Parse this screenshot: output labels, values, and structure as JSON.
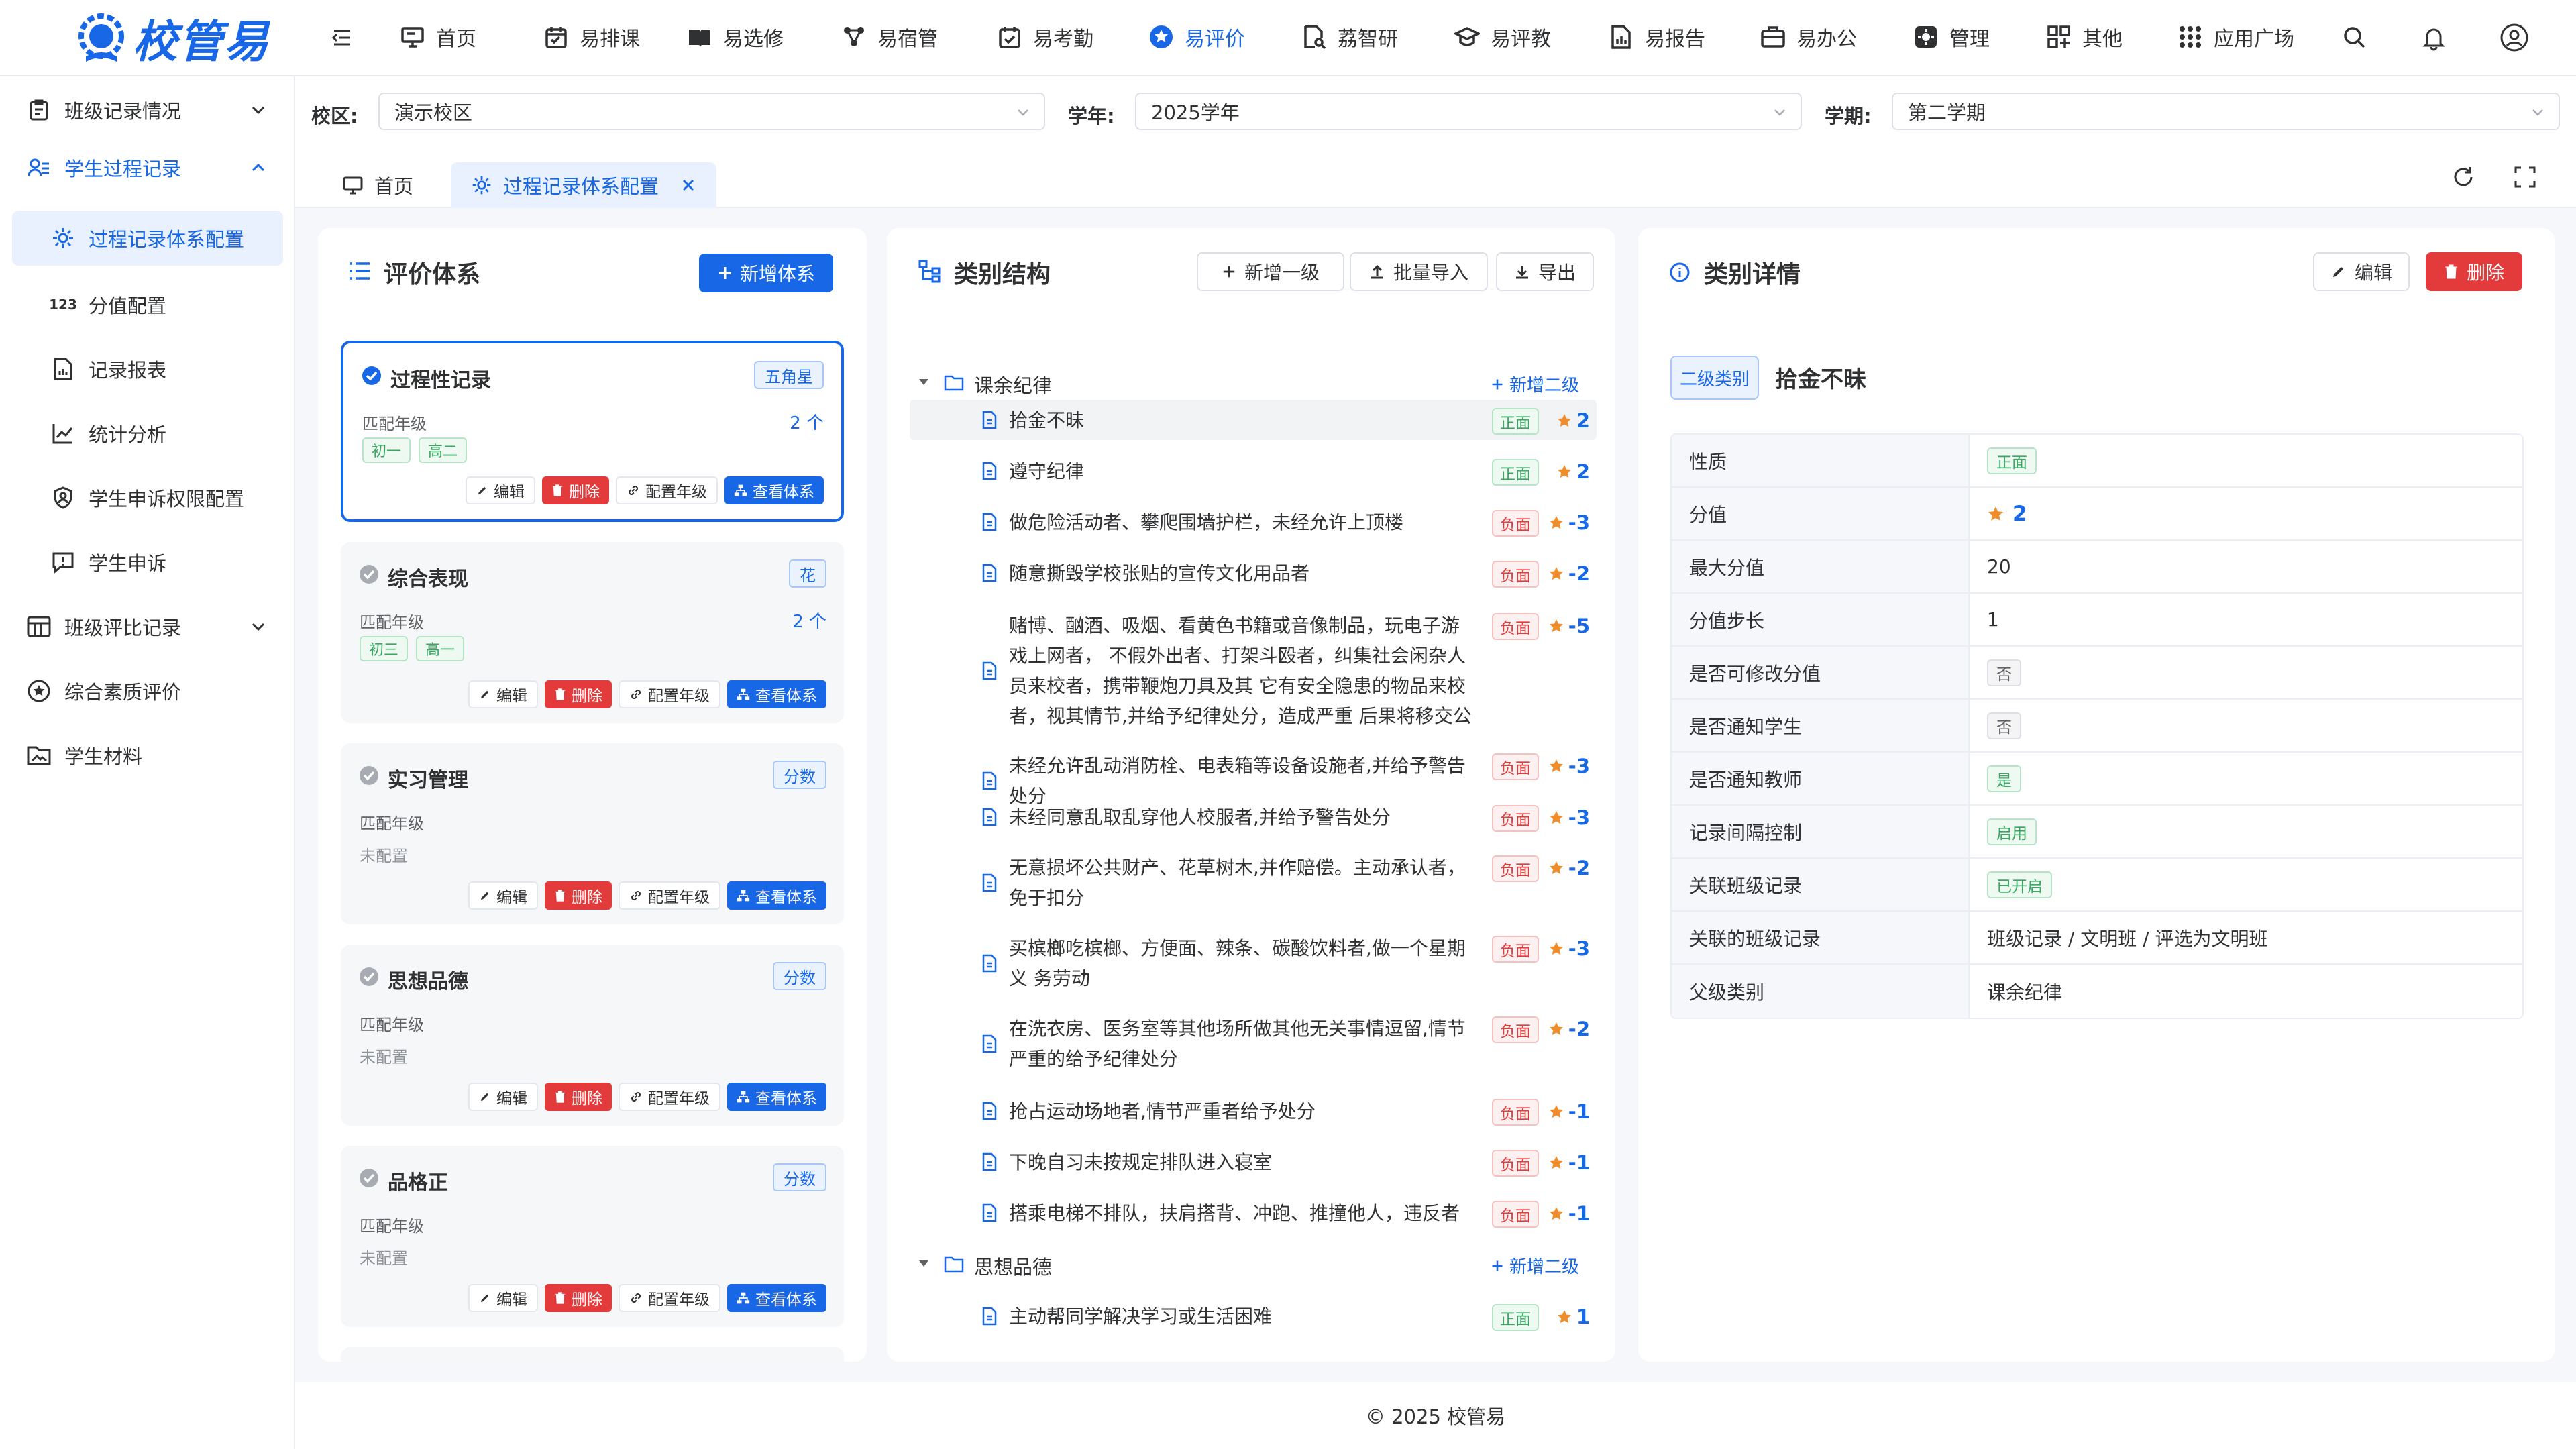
{
  "brand": {
    "name": "校管易"
  },
  "nav": {
    "items": [
      {
        "label": "首页",
        "icon": "monitor-icon"
      },
      {
        "label": "易排课",
        "icon": "calendar-icon"
      },
      {
        "label": "易选修",
        "icon": "book-icon"
      },
      {
        "label": "易宿管",
        "icon": "network-icon"
      },
      {
        "label": "易考勤",
        "icon": "checkbox-calendar-icon"
      },
      {
        "label": "易评价",
        "icon": "star-circle-icon"
      },
      {
        "label": "荔智研",
        "icon": "doc-search-icon"
      },
      {
        "label": "易评教",
        "icon": "graduation-cap-icon"
      },
      {
        "label": "易报告",
        "icon": "report-icon"
      },
      {
        "label": "易办公",
        "icon": "briefcase-icon"
      },
      {
        "label": "管理",
        "icon": "gear-box-icon"
      },
      {
        "label": "其他",
        "icon": "grid-plus-icon"
      },
      {
        "label": "应用广场",
        "icon": "apps-icon"
      }
    ],
    "active": "易评价"
  },
  "sidebar": {
    "items": [
      {
        "label": "班级记录情况",
        "icon": "clipboard-icon"
      },
      {
        "label": "学生过程记录",
        "icon": "user-list-icon"
      },
      {
        "label": "过程记录体系配置",
        "icon": "settings-icon"
      },
      {
        "label": "分值配置",
        "icon": "number-123-icon"
      },
      {
        "label": "记录报表",
        "icon": "report-file-icon"
      },
      {
        "label": "统计分析",
        "icon": "line-chart-icon"
      },
      {
        "label": "学生申诉权限配置",
        "icon": "shield-user-icon"
      },
      {
        "label": "学生申诉",
        "icon": "alert-message-icon"
      },
      {
        "label": "班级评比记录",
        "icon": "table-icon"
      },
      {
        "label": "综合素质评价",
        "icon": "star-circle-icon"
      },
      {
        "label": "学生材料",
        "icon": "folder-image-icon"
      }
    ]
  },
  "filters": {
    "campus_label": "校区:",
    "campus_value": "演示校区",
    "year_label": "学年:",
    "year_value": "2025学年",
    "term_label": "学期:",
    "term_value": "第二学期"
  },
  "tabs": {
    "home": "首页",
    "current": "过程记录体系配置"
  },
  "systems_panel": {
    "title": "评价体系",
    "add_button": "新增体系",
    "grade_label": "匹配年级",
    "none_label": "未配置",
    "actions": {
      "edit": "编辑",
      "delete": "删除",
      "config": "配置年级",
      "view": "查看体系"
    },
    "cards": [
      {
        "title": "过程性记录",
        "tag": "五角星",
        "count": "2 个",
        "grades": [
          "初一",
          "高二"
        ]
      },
      {
        "title": "综合表现",
        "tag": "花",
        "count": "2 个",
        "grades": [
          "初三",
          "高一"
        ]
      },
      {
        "title": "实习管理",
        "tag": "分数",
        "count": "",
        "grades": []
      },
      {
        "title": "思想品德",
        "tag": "分数",
        "count": "",
        "grades": []
      },
      {
        "title": "品格正",
        "tag": "分数",
        "count": "",
        "grades": []
      }
    ]
  },
  "structure_panel": {
    "title": "类别结构",
    "add_level1": "新增一级",
    "batch_import": "批量导入",
    "export": "导出",
    "add_level2": "新增二级",
    "groups": [
      {
        "label": "课余纪律",
        "items": [
          {
            "label": "拾金不昧",
            "type": "正面",
            "score": "2"
          },
          {
            "label": "遵守纪律",
            "type": "正面",
            "score": "2"
          },
          {
            "label": "做危险活动者、攀爬围墙护栏，未经允许上顶楼",
            "type": "负面",
            "score": "-3"
          },
          {
            "label": "随意撕毁学校张贴的宣传文化用品者",
            "type": "负面",
            "score": "-2"
          },
          {
            "label": "赌博、酗酒、吸烟、看黄色书籍或音像制品，玩电子游戏上网者， 不假外出者、打架斗殴者，纠集社会闲杂人员来校者，携带鞭炮刀具及其 它有安全隐患的物品来校者，视其情节,并给予纪律处分，造成严重 后果将移交公",
            "type": "负面",
            "score": "-5"
          },
          {
            "label": "未经允许乱动消防栓、电表箱等设备设施者,并给予警告处分",
            "type": "负面",
            "score": "-3"
          },
          {
            "label": "未经同意乱取乱穿他人校服者,并给予警告处分",
            "type": "负面",
            "score": "-3"
          },
          {
            "label": "无意损坏公共财产、花草树木,并作赔偿。主动承认者，免于扣分",
            "type": "负面",
            "score": "-2"
          },
          {
            "label": "买槟榔吃槟榔、方便面、辣条、碳酸饮料者,做一个星期义 务劳动",
            "type": "负面",
            "score": "-3"
          },
          {
            "label": "在洗衣房、医务室等其他场所做其他无关事情逗留,情节严重的给予纪律处分",
            "type": "负面",
            "score": "-2"
          },
          {
            "label": "抢占运动场地者,情节严重者给予处分",
            "type": "负面",
            "score": "-1"
          },
          {
            "label": "下晚自习未按规定排队进入寝室",
            "type": "负面",
            "score": "-1"
          },
          {
            "label": "搭乘电梯不排队，扶肩搭背、冲跑、推撞他人，违反者",
            "type": "负面",
            "score": "-1"
          }
        ]
      },
      {
        "label": "思想品德",
        "items": [
          {
            "label": "主动帮同学解决学习或生活困难",
            "type": "正面",
            "score": "1"
          }
        ]
      }
    ]
  },
  "detail_panel": {
    "title": "类别详情",
    "edit": "编辑",
    "delete": "删除",
    "level_tag": "二级类别",
    "name": "拾金不昧",
    "rows": [
      {
        "key": "性质",
        "value": "正面"
      },
      {
        "key": "分值",
        "value": "2"
      },
      {
        "key": "最大分值",
        "value": "20"
      },
      {
        "key": "分值步长",
        "value": "1"
      },
      {
        "key": "是否可修改分值",
        "value": "否"
      },
      {
        "key": "是否通知学生",
        "value": "否"
      },
      {
        "key": "是否通知教师",
        "value": "是"
      },
      {
        "key": "记录间隔控制",
        "value": "启用"
      },
      {
        "key": "关联班级记录",
        "value": "已开启"
      },
      {
        "key": "关联的班级记录",
        "value": "班级记录 / 文明班 / 评选为文明班"
      },
      {
        "key": "父级类别",
        "value": "课余纪律"
      }
    ]
  },
  "footer": {
    "text": "© 2025 校管易"
  },
  "colors": {
    "accent": "#1767e6",
    "danger": "#e33b3b",
    "positive": "#3aa763",
    "star": "#f08c2a"
  }
}
